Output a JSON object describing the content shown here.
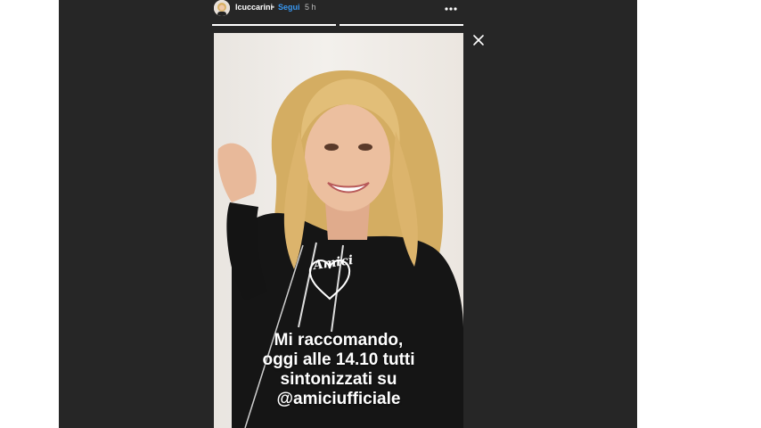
{
  "story": {
    "username": "lcuccarini",
    "separator": "•",
    "follow_label": "Segui",
    "time_ago": "5 h",
    "more_icon": "more-horizontal-icon",
    "close_icon": "close-icon",
    "progress_segments": 2,
    "progress_fraction_current": 1.0
  },
  "caption": {
    "lines": [
      "Mi raccomando,",
      "oggi alle 14.10 tutti",
      "sintonizzati su",
      "@amiciufficiale"
    ]
  },
  "shirt_logo": "Amici",
  "colors": {
    "stage_bg": "#262626",
    "follow": "#3897f0",
    "caption_text": "#ffffff",
    "hoodie": "#111111",
    "hair": "#d9b56b"
  }
}
